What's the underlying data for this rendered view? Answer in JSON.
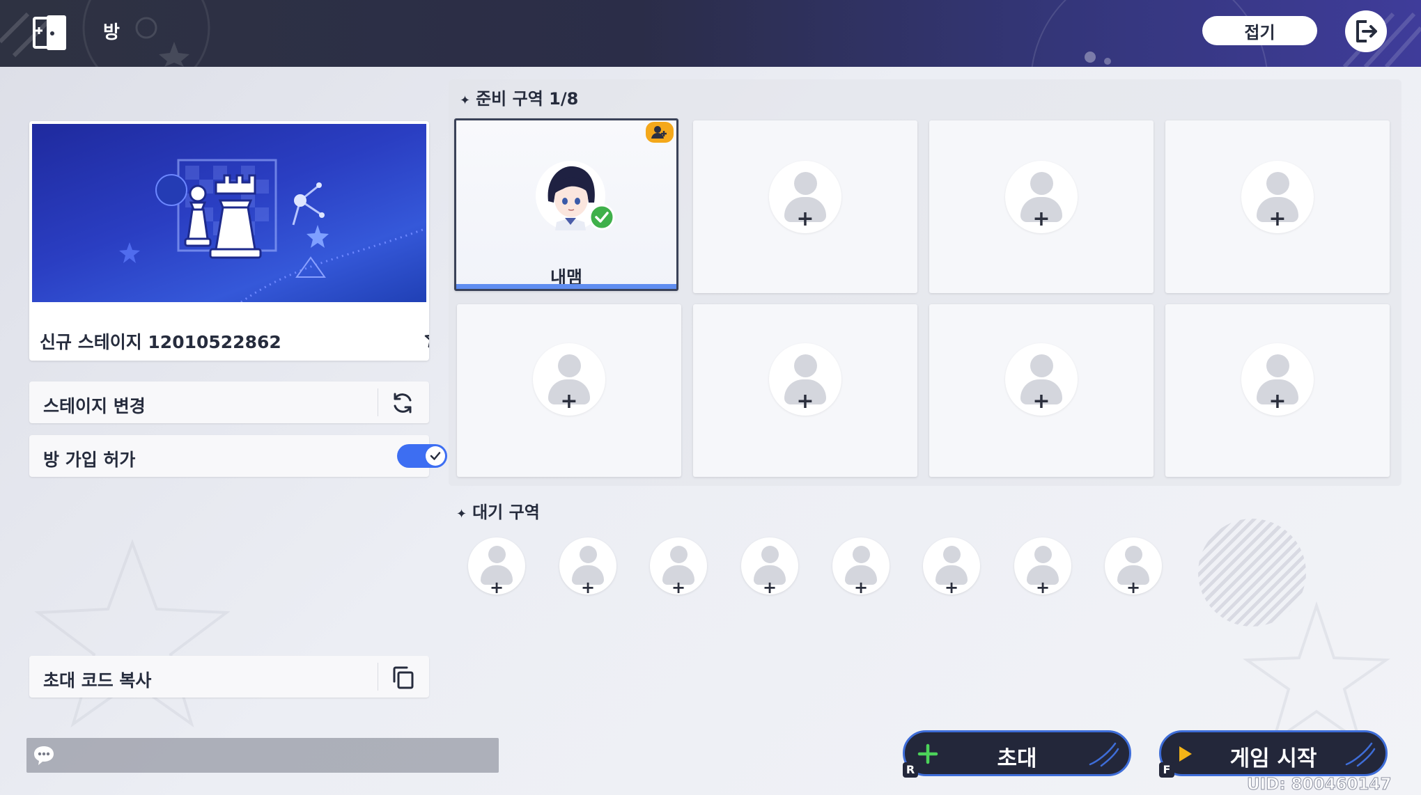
{
  "topbar": {
    "title": "방",
    "collapse_label": "접기",
    "room_icon": "room-door-icon",
    "exit_icon": "exit-icon"
  },
  "stage": {
    "name": "신규 스테이지 12010522862",
    "favorite_icon": "star-outline-icon"
  },
  "options": {
    "change_stage_label": "스테이지 변경",
    "allow_join_label": "방 가입 허가",
    "allow_join_on": true,
    "copy_invite_label": "초대 코드 복사"
  },
  "ready_area": {
    "title": "준비 구역 1/8",
    "slots": [
      {
        "player": "내맴",
        "ready": true,
        "host": true
      },
      {
        "player": null
      },
      {
        "player": null
      },
      {
        "player": null
      },
      {
        "player": null
      },
      {
        "player": null
      },
      {
        "player": null
      },
      {
        "player": null
      }
    ]
  },
  "waiting_area": {
    "title": "대기 구역",
    "slot_count": 8
  },
  "buttons": {
    "invite_label": "초대",
    "invite_key": "R",
    "start_label": "게임 시작",
    "start_key": "F"
  },
  "uid": "UID: 800460147",
  "colors": {
    "accent_blue": "#3d6ef2",
    "ready_green": "#3fb04a",
    "host_badge": "#f4a81b",
    "button_dark": "#23273a"
  }
}
